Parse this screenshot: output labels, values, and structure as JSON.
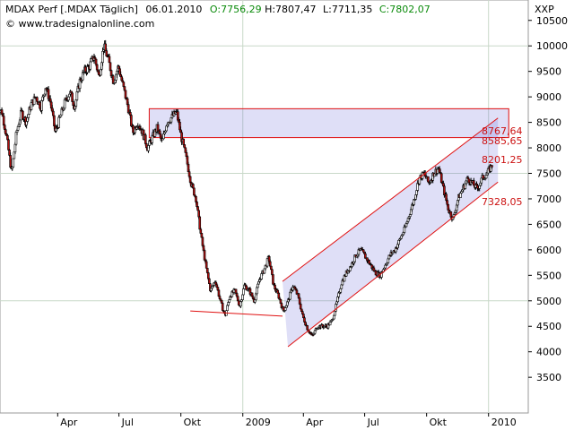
{
  "chart_data": {
    "type": "candlestick",
    "header": {
      "instrument": "MDAX Perf [.MDAX  Täglich]",
      "date": "06.01.2010",
      "open": "O:7756,29",
      "high": "H:7807,47",
      "low": "L:7711,35",
      "close": "C:7802,07"
    },
    "watermark": "© www.tradesignalonline.com",
    "currency_label": "XXP",
    "ylim": [
      2800,
      10900
    ],
    "y_ticks": [
      3500,
      4000,
      4500,
      5000,
      5500,
      6000,
      6500,
      7000,
      7500,
      8000,
      8500,
      9000,
      9500,
      10000,
      10500
    ],
    "x_ticks": [
      {
        "label": "Apr",
        "date": "2008-04"
      },
      {
        "label": "Jul",
        "date": "2008-07"
      },
      {
        "label": "Okt",
        "date": "2008-10"
      },
      {
        "label": "2009",
        "date": "2009-01"
      },
      {
        "label": "Apr",
        "date": "2009-04"
      },
      {
        "label": "Jul",
        "date": "2009-07"
      },
      {
        "label": "Okt",
        "date": "2009-10"
      },
      {
        "label": "2010",
        "date": "2010-01"
      }
    ],
    "series": [
      {
        "values": [
          8800,
          8700,
          8200,
          7500,
          8300,
          8700,
          8500,
          8850,
          9000,
          8800,
          9200,
          8900,
          8300,
          8600,
          8900,
          9100,
          8800,
          9300,
          9500,
          9600,
          9800,
          9400,
          10000,
          9700,
          9300,
          9600,
          9200,
          8800,
          8300,
          8500,
          8300,
          8000,
          8200,
          8400,
          8100,
          8500,
          8600,
          8700,
          8200,
          7800,
          7300,
          7000,
          6300,
          5700,
          5200,
          5400,
          5000,
          4700,
          5100,
          5200,
          4900,
          5300,
          5200,
          5000,
          5400,
          5600,
          5850,
          5300,
          5100,
          4800,
          5000,
          5300,
          5100,
          4700,
          4450,
          4300,
          4500,
          4500,
          4500,
          4600,
          4950,
          5350,
          5550,
          5700,
          5900,
          6000,
          5850,
          5700,
          5550,
          5500,
          5700,
          5900,
          6000,
          6200,
          6400,
          6700,
          7000,
          7400,
          7500,
          7300,
          7500,
          7600,
          7200,
          6800,
          6600,
          7000,
          7200,
          7400,
          7300,
          7200,
          7400,
          7500,
          7650
        ]
      }
    ],
    "ranges": [
      {
        "x": [
          "2008-08-15",
          "2010-01-31"
        ],
        "y": [
          8201.25,
          8767.64
        ]
      }
    ],
    "lines": [
      {
        "x": [
          "2008-10-15",
          "2009-03-01"
        ],
        "y": [
          4800,
          4700
        ]
      },
      {
        "x": [
          "2009-03-09",
          "2010-01-15"
        ],
        "y": [
          4100,
          7328.05
        ]
      },
      {
        "x": [
          "2009-03-01",
          "2010-01-15"
        ],
        "y": [
          5380,
          8585.65
        ]
      }
    ],
    "level_labels": [
      "8767,64",
      "8585,65",
      "8201,25",
      "7328,05"
    ],
    "xlabel": "",
    "ylabel": "",
    "grid": true
  }
}
